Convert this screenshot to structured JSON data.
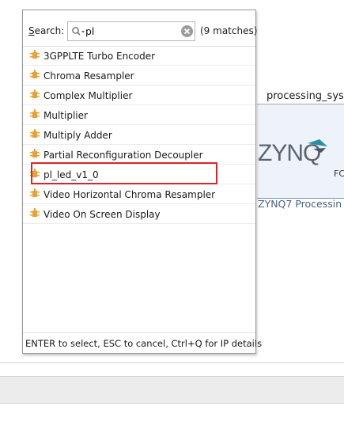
{
  "canvas": {
    "block_title": "processing_sys",
    "block_fc_label": "FC",
    "block_caption": "ZYNQ7 Processin",
    "logo_text": "ZYNQ"
  },
  "popup": {
    "search_label_mnemonic": "S",
    "search_label_rest": "earch:",
    "search_value": "pl",
    "match_count": "(9 matches)",
    "items": [
      {
        "label": "3GPPLTE Turbo Encoder"
      },
      {
        "label": "Chroma Resampler"
      },
      {
        "label": "Complex Multiplier"
      },
      {
        "label": "Multiplier"
      },
      {
        "label": "Multiply Adder"
      },
      {
        "label": "Partial Reconfiguration Decoupler"
      },
      {
        "label": "pl_led_v1_0"
      },
      {
        "label": "Video Horizontal Chroma Resampler"
      },
      {
        "label": "Video On Screen Display"
      }
    ],
    "footer_hint": "ENTER to select, ESC to cancel, Ctrl+Q for IP details"
  },
  "icons": {
    "search": "search-icon",
    "clear": "clear-icon",
    "ip": "ip-core-icon"
  },
  "colors": {
    "highlight": "#d7272b",
    "ip_icon": "#e6a23a",
    "caption": "#4b6287"
  }
}
